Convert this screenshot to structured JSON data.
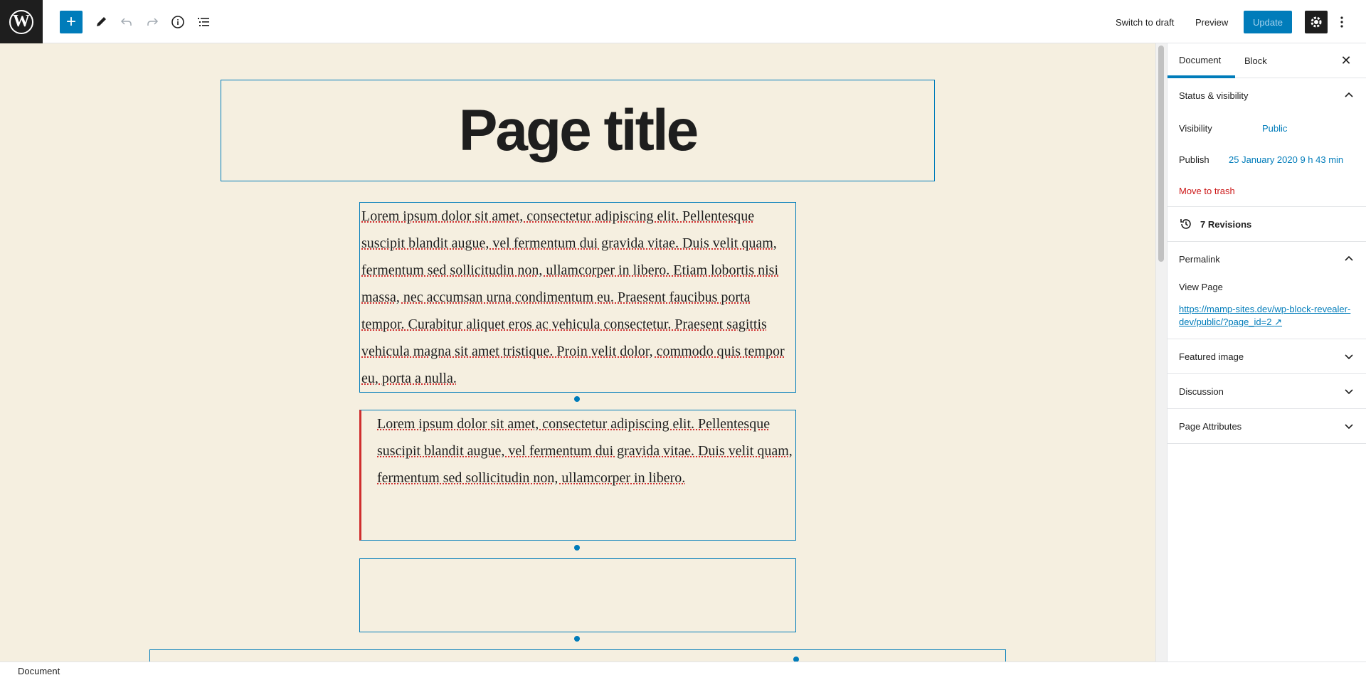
{
  "toolbar": {
    "logo": "W",
    "add": "+",
    "switch_to_draft": "Switch to draft",
    "preview": "Preview",
    "update": "Update"
  },
  "editor": {
    "title": "Page title",
    "paragraph1": "Lorem ipsum dolor sit amet, consectetur adipiscing elit. Pellentesque suscipit blandit augue, vel fermentum dui gravida vitae. Duis velit quam, fermentum sed sollicitudin non, ullamcorper in libero. Etiam lobortis nisi massa, nec accumsan urna condimentum eu. Praesent faucibus porta tempor. Curabitur aliquet eros ac vehicula consectetur. Praesent sagittis vehicula magna sit amet tristique. Proin velit dolor, commodo quis tempor eu, porta a nulla.",
    "paragraph2": "Lorem ipsum dolor sit amet, consectetur adipiscing elit. Pellentesque suscipit blandit augue, vel fermentum dui gravida vitae. Duis velit quam, fermentum sed sollicitudin non, ullamcorper in libero."
  },
  "sidebar": {
    "tabs": {
      "document": "Document",
      "block": "Block"
    },
    "status": {
      "title": "Status & visibility",
      "visibility_label": "Visibility",
      "visibility_value": "Public",
      "publish_label": "Publish",
      "publish_value": "25 January 2020 9 h 43 min",
      "trash": "Move to trash"
    },
    "revisions": "7 Revisions",
    "permalink": {
      "title": "Permalink",
      "view_page": "View Page",
      "url": "https://mamp-sites.dev/wp-block-revealer-dev/public/?page_id=2"
    },
    "featured_image": "Featured image",
    "discussion": "Discussion",
    "page_attributes": "Page Attributes"
  },
  "footer": {
    "breadcrumb": "Document"
  },
  "colors": {
    "accent": "#007cba",
    "canvas": "#f5efe0",
    "danger": "#cc1818"
  }
}
